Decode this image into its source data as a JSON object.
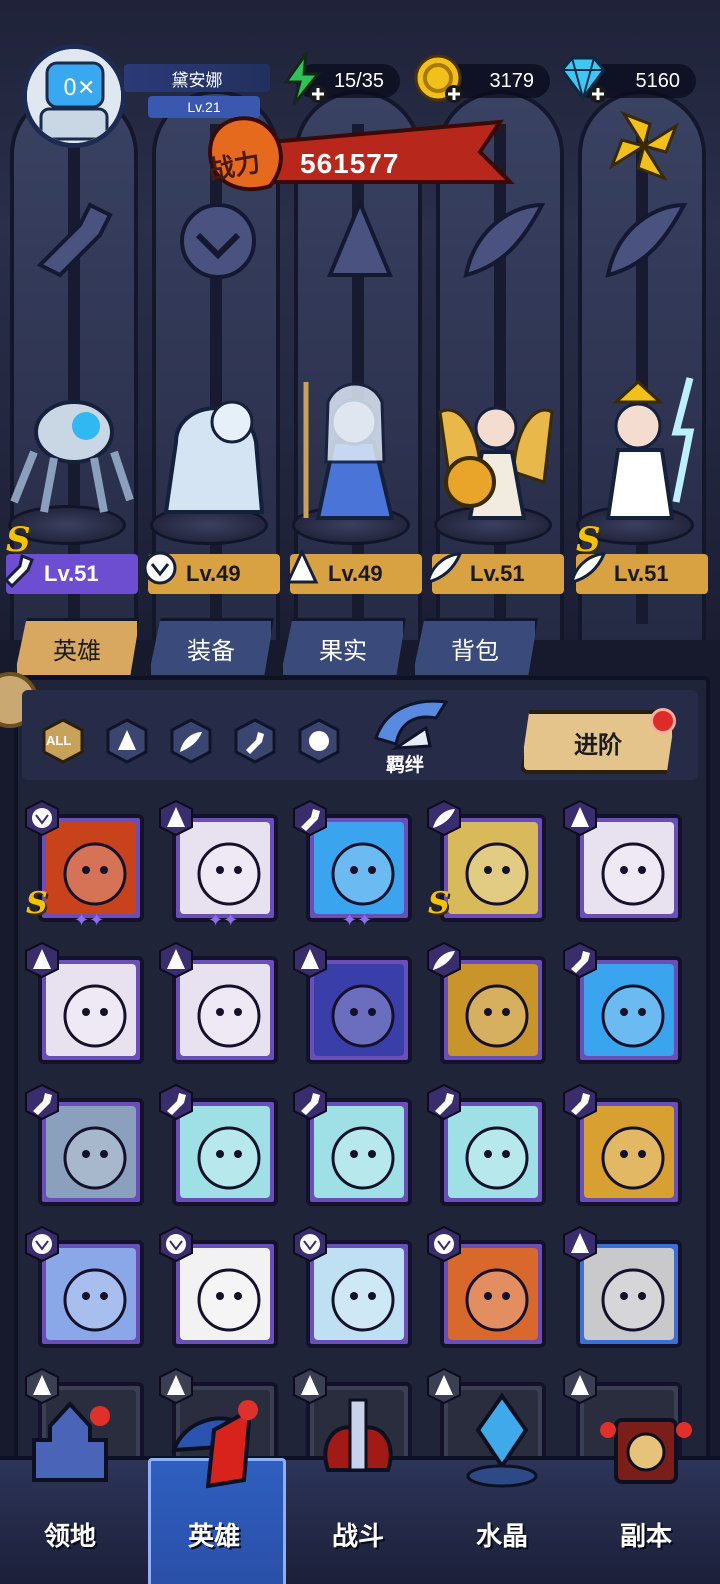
{
  "player": {
    "name": "黛安娜",
    "level": "Lv.21"
  },
  "resources": {
    "energy": "15/35",
    "gold": "3179",
    "gems": "5160"
  },
  "power": {
    "label": "战力",
    "value": "561577"
  },
  "stage_heroes": [
    {
      "level": "Lv.51",
      "class": "wrench",
      "rank": "S",
      "tag_color": "#6e4ed0"
    },
    {
      "level": "Lv.49",
      "class": "beast",
      "rank": "",
      "tag_color": "#d8a242"
    },
    {
      "level": "Lv.49",
      "class": "mage",
      "rank": "",
      "tag_color": "#d8a242"
    },
    {
      "level": "Lv.51",
      "class": "wing",
      "rank": "",
      "tag_color": "#d8a242"
    },
    {
      "level": "Lv.51",
      "class": "wing",
      "rank": "S",
      "tag_color": "#d8a242"
    }
  ],
  "tabs": [
    {
      "label": "英雄",
      "active": true
    },
    {
      "label": "装备",
      "active": false
    },
    {
      "label": "果实",
      "active": false
    },
    {
      "label": "背包",
      "active": false
    }
  ],
  "filters": {
    "all_label": "ALL",
    "bond_label": "羁绊",
    "advance_label": "进阶"
  },
  "hero_cards": [
    {
      "class": "beast",
      "portrait": "lion-beast",
      "rank": "S",
      "stars": "✦✦",
      "frame": "purple"
    },
    {
      "class": "mage",
      "portrait": "bandaged-nun",
      "rank": "",
      "stars": "✦✦",
      "frame": "purple"
    },
    {
      "class": "wrench",
      "portrait": "fishbowl-robot",
      "rank": "",
      "stars": "✦✦",
      "frame": "purple"
    },
    {
      "class": "wing",
      "portrait": "armored-knight",
      "rank": "S",
      "stars": "",
      "frame": "purple"
    },
    {
      "class": "mage",
      "portrait": "bandaged-nun",
      "rank": "",
      "stars": "",
      "frame": "purple"
    },
    {
      "class": "mage",
      "portrait": "bandaged-nun",
      "rank": "",
      "stars": "",
      "frame": "purple"
    },
    {
      "class": "mage",
      "portrait": "bandaged-nun",
      "rank": "",
      "stars": "",
      "frame": "purple"
    },
    {
      "class": "mage",
      "portrait": "wizard-brain",
      "rank": "",
      "stars": "",
      "frame": "purple"
    },
    {
      "class": "wing",
      "portrait": "egyptian-queen",
      "rank": "",
      "stars": "",
      "frame": "purple"
    },
    {
      "class": "wrench",
      "portrait": "fishbowl-robot",
      "rank": "",
      "stars": "",
      "frame": "purple"
    },
    {
      "class": "wrench",
      "portrait": "robot-chest",
      "rank": "",
      "stars": "",
      "frame": "purple"
    },
    {
      "class": "wrench",
      "portrait": "crystal-golem",
      "rank": "",
      "stars": "",
      "frame": "purple"
    },
    {
      "class": "wrench",
      "portrait": "crystal-golem",
      "rank": "",
      "stars": "",
      "frame": "purple"
    },
    {
      "class": "wrench",
      "portrait": "crystal-golem",
      "rank": "",
      "stars": "",
      "frame": "purple"
    },
    {
      "class": "wrench",
      "portrait": "red-mech",
      "rank": "",
      "stars": "",
      "frame": "purple"
    },
    {
      "class": "beast",
      "portrait": "ice-dragon",
      "rank": "",
      "stars": "",
      "frame": "purple"
    },
    {
      "class": "beast",
      "portrait": "panda",
      "rank": "",
      "stars": "",
      "frame": "purple"
    },
    {
      "class": "beast",
      "portrait": "polar-bear",
      "rank": "",
      "stars": "",
      "frame": "purple"
    },
    {
      "class": "beast",
      "portrait": "fox-warrior",
      "rank": "",
      "stars": "",
      "frame": "purple"
    },
    {
      "class": "mage",
      "portrait": "steel-helmet",
      "rank": "",
      "stars": "",
      "frame": "blue"
    }
  ],
  "bottom_nav": [
    {
      "label": "领地",
      "active": false,
      "icon": "castle-icon"
    },
    {
      "label": "英雄",
      "active": true,
      "icon": "hero-icon"
    },
    {
      "label": "战斗",
      "active": false,
      "icon": "battle-icon"
    },
    {
      "label": "水晶",
      "active": false,
      "icon": "crystal-icon"
    },
    {
      "label": "副本",
      "active": false,
      "icon": "dungeon-icon"
    }
  ],
  "colors": {
    "accent_gold": "#d9a860",
    "card_purple": "#6a4fb8",
    "card_blue": "#3a6fd8",
    "power_red": "#b8271c",
    "nav_active": "#2e5fc0"
  }
}
